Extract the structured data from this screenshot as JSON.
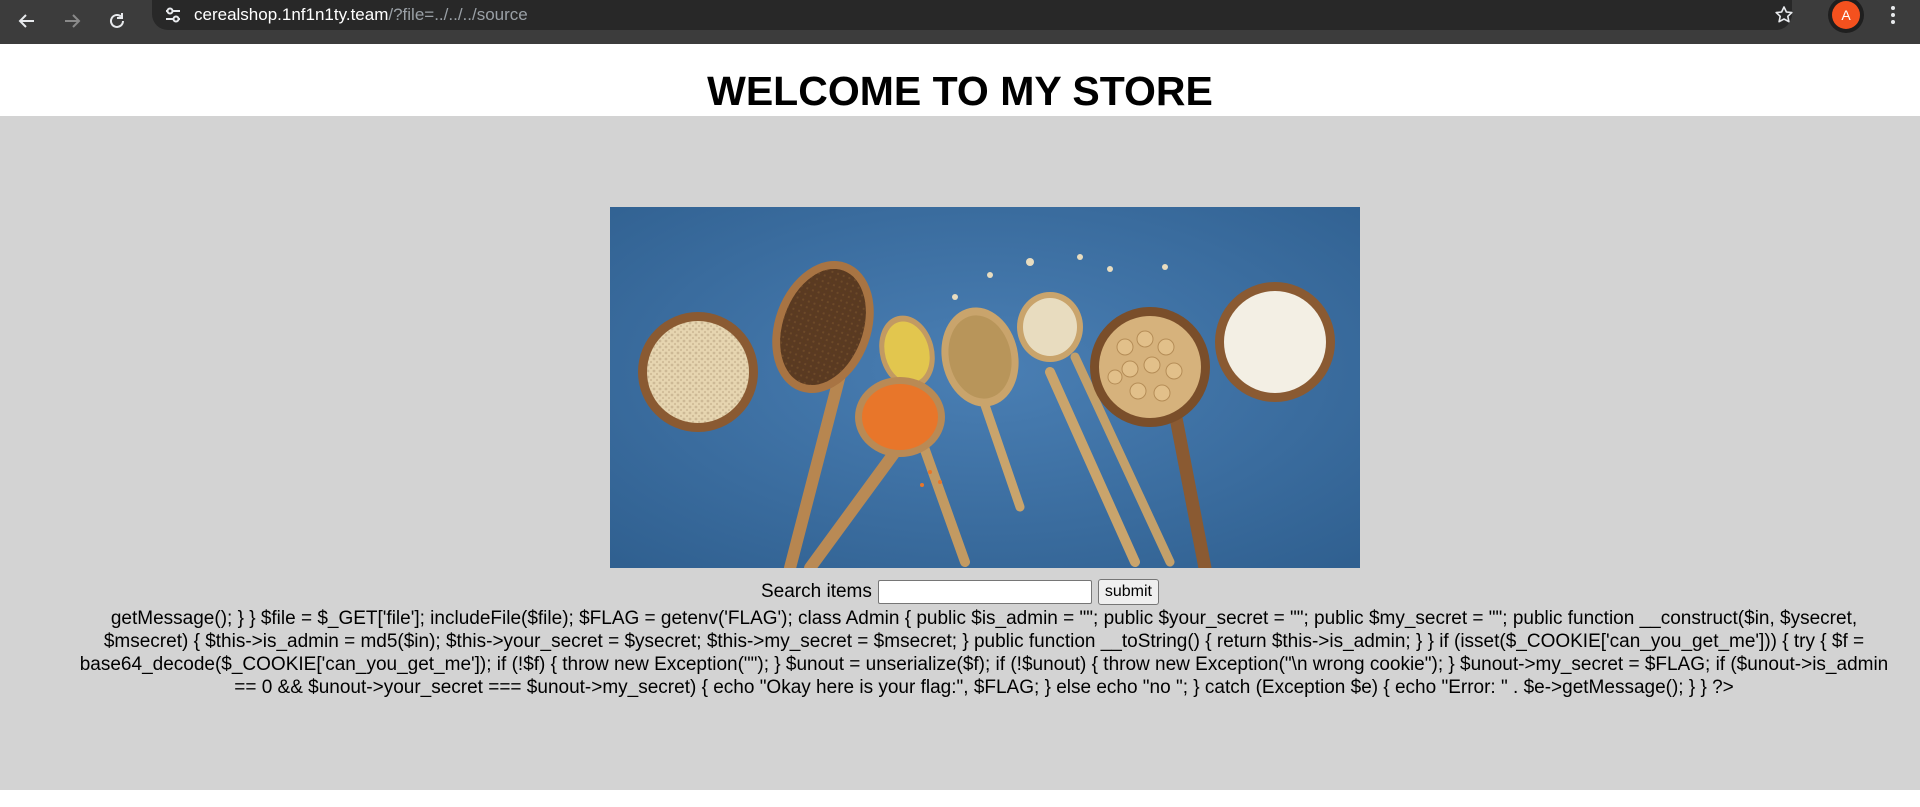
{
  "browser": {
    "url_host": "cerealshop.1nf1n1ty.team",
    "url_rest": "/?file=../../../source",
    "avatar_letter": "A"
  },
  "page": {
    "heading": "WELCOME TO MY STORE",
    "image_alt": "spoons and bowls of grains and cereals",
    "search_label": "Search items",
    "search_value": "",
    "submit_label": "submit",
    "source_lines": [
      "getMessage(); } } $file = $_GET['file']; includeFile($file); $FLAG = getenv('FLAG'); class Admin { public $is_admin = \"\"; public $your_secret = \"\"; public $my_secret = \"\"; public function __construct($in, $ysecret,",
      "$msecret) { $this->is_admin = md5($in); $this->your_secret = $ysecret; $this->my_secret = $msecret; } public function __toString() { return $this->is_admin; } } if (isset($_COOKIE['can_you_get_me'])) { try { $f =",
      "base64_decode($_COOKIE['can_you_get_me']); if (!$f) { throw new Exception(\"\"); } $unout = unserialize($f); if (!$unout) { throw new Exception(\"\\n wrong cookie\"); } $unout->my_secret = $FLAG; if ($unout->is_admin",
      "== 0 && $unout->your_secret === $unout->my_secret) { echo \"Okay here is your flag:\", $FLAG; } else echo \"no \"; } catch (Exception $e) { echo \"Error: \" . $e->getMessage(); } } ?>"
    ]
  },
  "colors": {
    "chrome_bg": "#3c3c3c",
    "omnibox_bg": "#282828",
    "page_grey": "#d3d3d3",
    "avatar_bg": "#f4511e"
  }
}
